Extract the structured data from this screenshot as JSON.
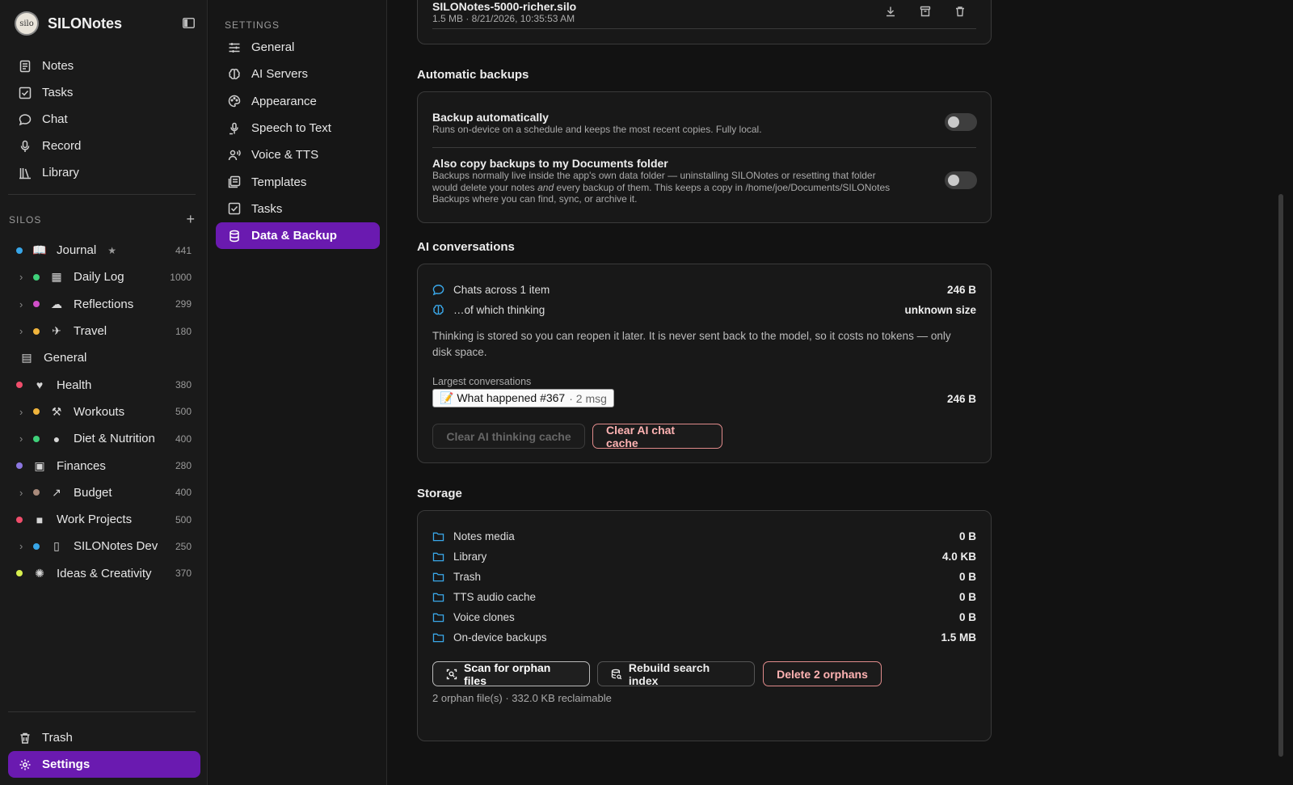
{
  "app": {
    "title": "SILONotes",
    "logo_text": "silo"
  },
  "nav": [
    {
      "label": "Notes",
      "icon": "notes-icon"
    },
    {
      "label": "Tasks",
      "icon": "tasks-icon"
    },
    {
      "label": "Chat",
      "icon": "chat-icon"
    },
    {
      "label": "Record",
      "icon": "mic-icon"
    },
    {
      "label": "Library",
      "icon": "library-icon"
    }
  ],
  "silos_header": "SILOS",
  "silos": [
    {
      "label": "Journal",
      "count": "441",
      "color": "#38a6e8",
      "icon": "book-icon",
      "starred": true,
      "level": "top"
    },
    {
      "label": "Daily Log",
      "count": "1000",
      "color": "#3fd17a",
      "icon": "calendar-icon",
      "level": "child"
    },
    {
      "label": "Reflections",
      "count": "299",
      "color": "#d14fc9",
      "icon": "thought-icon",
      "level": "child"
    },
    {
      "label": "Travel",
      "count": "180",
      "color": "#f0b43c",
      "icon": "plane-icon",
      "level": "child"
    },
    {
      "label": "General",
      "count": "",
      "color": "",
      "icon": "notebook-icon",
      "level": "plain"
    },
    {
      "label": "Health",
      "count": "380",
      "color": "#ef4d6b",
      "icon": "heart-icon",
      "level": "top"
    },
    {
      "label": "Workouts",
      "count": "500",
      "color": "#f0b43c",
      "icon": "dumbbell-icon",
      "level": "child"
    },
    {
      "label": "Diet & Nutrition",
      "count": "400",
      "color": "#3fd17a",
      "icon": "apple-icon",
      "level": "child"
    },
    {
      "label": "Finances",
      "count": "280",
      "color": "#8b76e0",
      "icon": "money-icon",
      "level": "top"
    },
    {
      "label": "Budget",
      "count": "400",
      "color": "#a98a7b",
      "icon": "chart-icon",
      "level": "child"
    },
    {
      "label": "Work Projects",
      "count": "500",
      "color": "#ef4d6b",
      "icon": "briefcase-icon",
      "level": "top"
    },
    {
      "label": "SILONotes Dev",
      "count": "250",
      "color": "#38a6e8",
      "icon": "phone-icon",
      "level": "child"
    },
    {
      "label": "Ideas & Creativity",
      "count": "370",
      "color": "#d7ef4e",
      "icon": "bulb-icon",
      "level": "top"
    }
  ],
  "bottom_nav": {
    "trash": "Trash",
    "settings": "Settings"
  },
  "settings_nav": {
    "header": "SETTINGS",
    "items": [
      "General",
      "AI Servers",
      "Appearance",
      "Speech to Text",
      "Voice & TTS",
      "Templates",
      "Tasks",
      "Data & Backup"
    ]
  },
  "backup_file": {
    "name": "SILONotes-5000-richer.silo",
    "meta": "1.5 MB · 8/21/2026, 10:35:53 AM"
  },
  "auto_backups": {
    "title": "Automatic backups",
    "row1": {
      "title": "Backup automatically",
      "sub": "Runs on-device on a schedule and keeps the most recent copies. Fully local."
    },
    "row2": {
      "title": "Also copy backups to my Documents folder",
      "sub_a": "Backups normally live inside the app's own data folder — uninstalling SILONotes or resetting that folder",
      "sub_b1": "would delete your notes ",
      "sub_b_em": "and",
      "sub_b2": " every backup of them. This keeps a copy in /home/joe/Documents/SILONotes",
      "sub_c": "Backups where you can find, sync, or archive it."
    }
  },
  "ai": {
    "title": "AI conversations",
    "chats_label": "Chats across 1 item",
    "chats_val": "246 B",
    "thinking_label": "…of which thinking",
    "thinking_val": "unknown size",
    "note_line1": "Thinking is stored so you can reopen it later. It is never sent back to the model, so it costs no tokens — only",
    "note_line2": "disk space.",
    "largest_label": "Largest conversations",
    "conv_title": "📝 What happened #367",
    "conv_meta": "· 2 msg",
    "conv_size": "246 B",
    "btn_clear_thinking": "Clear AI thinking cache",
    "btn_clear_chat": "Clear AI chat cache"
  },
  "storage": {
    "title": "Storage",
    "rows": [
      {
        "label": "Notes media",
        "value": "0 B"
      },
      {
        "label": "Library",
        "value": "4.0 KB"
      },
      {
        "label": "Trash",
        "value": "0 B"
      },
      {
        "label": "TTS audio cache",
        "value": "0 B"
      },
      {
        "label": "Voice clones",
        "value": "0 B"
      },
      {
        "label": "On-device backups",
        "value": "1.5 MB"
      }
    ],
    "btn_scan": "Scan for orphan files",
    "btn_rebuild": "Rebuild search index",
    "btn_delete": "Delete 2 orphans",
    "footer": "2 orphan file(s) · 332.0 KB reclaimable"
  },
  "colors": {
    "accent": "#6a1ab0",
    "folder_icon": "#3aa7e8"
  }
}
